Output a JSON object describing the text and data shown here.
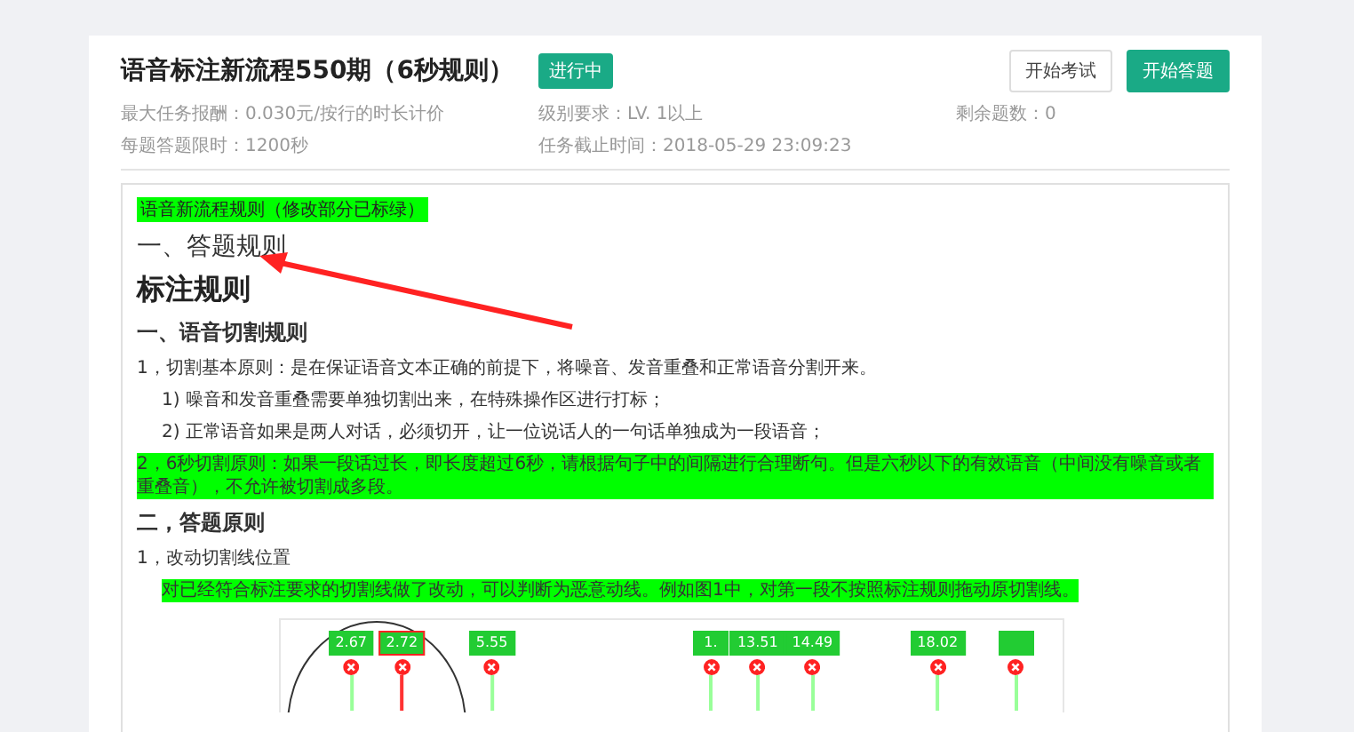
{
  "task": {
    "title": "语音标注新流程550期（6秒规则）",
    "status": "进行中",
    "meta": [
      {
        "text": "最大任务报酬：0.030元/按行的时长计价"
      },
      {
        "text": "级别要求：LV. 1以上"
      },
      {
        "text": "剩余题数：0"
      },
      {
        "text": "每题答题限时：1200秒"
      },
      {
        "text": "任务截止时间：2018-05-29 23:09:23"
      }
    ],
    "buttons": [
      {
        "label": "开始考试",
        "kind": "secondary"
      },
      {
        "label": "开始答题",
        "kind": "primary"
      }
    ]
  },
  "content": [
    {
      "kind": "tag",
      "text": "语音新流程规则（修改部分已标绿）"
    },
    {
      "kind": "h2",
      "text": "一、答题规则"
    },
    {
      "kind": "h1",
      "text": "标注规则"
    },
    {
      "kind": "h3",
      "text": "一、语音切割规则"
    },
    {
      "kind": "p",
      "text": "1，切割基本原则：是在保证语音文本正确的前提下，将噪音、发音重叠和正常语音分割开来。"
    },
    {
      "kind": "indent",
      "text": "1) 噪音和发音重叠需要单独切割出来，在特殊操作区进行打标；"
    },
    {
      "kind": "indent",
      "text": "2) 正常语音如果是两人对话，必须切开，让一位说话人的一句话单独成为一段语音；"
    },
    {
      "kind": "highlight",
      "text": "2，6秒切割原则：如果一段话过长，即长度超过6秒，请根据句子中的间隔进行合理断句。但是六秒以下的有效语音（中间没有噪音或者重叠音），不允许被切割成多段。"
    },
    {
      "kind": "h3",
      "text": "二，答题原则"
    },
    {
      "kind": "p",
      "text": "1，改动切割线位置"
    },
    {
      "kind": "indent-highlight",
      "text": "对已经符合标注要求的切割线做了改动，可以判断为恶意动线。例如图1中，对第一段不按照标注规则拖动原切割线。"
    }
  ],
  "timeline": {
    "markers": [
      {
        "label": "2.67",
        "selected": false
      },
      {
        "label": "2.72",
        "selected": true
      },
      {
        "label": "5.55",
        "selected": false
      },
      {
        "label": "1.",
        "selected": false
      },
      {
        "label": "13.51",
        "selected": false
      },
      {
        "label": "14.49",
        "selected": false
      },
      {
        "label": "18.02",
        "selected": false
      },
      {
        "selected": false
      }
    ]
  }
}
